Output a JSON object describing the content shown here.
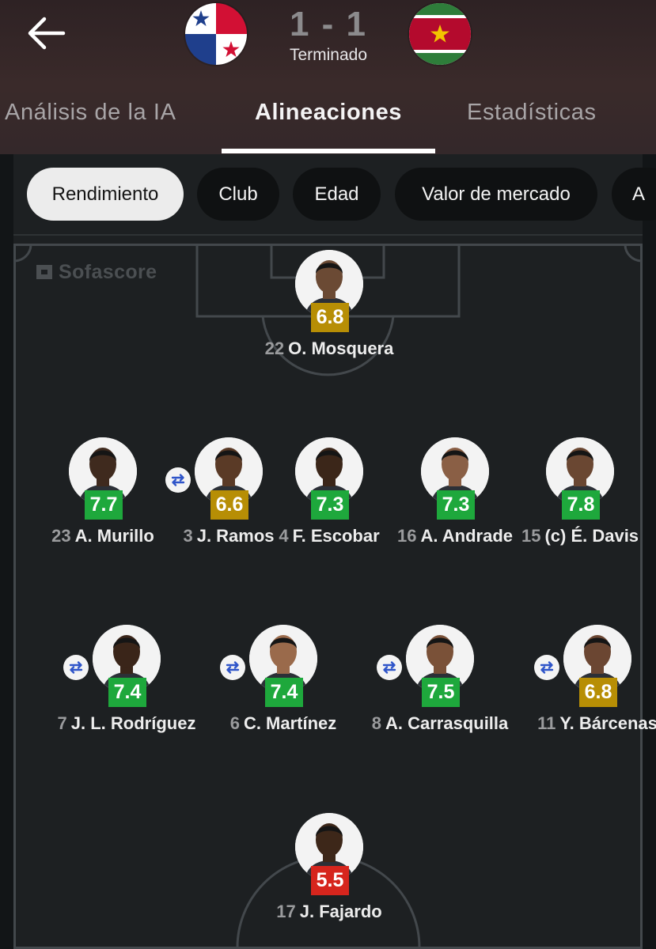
{
  "match": {
    "score": "1 - 1",
    "status": "Terminado",
    "home_team_flag": "panama-flag",
    "away_team_flag": "suriname-flag"
  },
  "tabs": [
    {
      "label": "Análisis de la IA",
      "active": false
    },
    {
      "label": "Alineaciones",
      "active": true
    },
    {
      "label": "Estadísticas",
      "active": false
    }
  ],
  "filters": [
    {
      "label": "Rendimiento",
      "active": true
    },
    {
      "label": "Club",
      "active": false
    },
    {
      "label": "Edad",
      "active": false
    },
    {
      "label": "Valor de mercado",
      "active": false
    },
    {
      "label": "A",
      "active": false
    }
  ],
  "watermark": "Sofascore",
  "players": [
    {
      "number": "22",
      "name": "O. Mosquera",
      "rating": "6.8",
      "rating_color": "gold",
      "substituted": false
    },
    {
      "number": "23",
      "name": "A. Murillo",
      "rating": "7.7",
      "rating_color": "green",
      "substituted": false
    },
    {
      "number": "3",
      "name": "J. Ramos",
      "rating": "6.6",
      "rating_color": "gold",
      "substituted": true
    },
    {
      "number": "4",
      "name": "F. Escobar",
      "rating": "7.3",
      "rating_color": "green",
      "substituted": false
    },
    {
      "number": "16",
      "name": "A. Andrade",
      "rating": "7.3",
      "rating_color": "green",
      "substituted": false
    },
    {
      "number": "15",
      "name": "(c) É. Davis",
      "rating": "7.8",
      "rating_color": "green",
      "substituted": false
    },
    {
      "number": "7",
      "name": "J. L. Rodríguez",
      "rating": "7.4",
      "rating_color": "green",
      "substituted": true
    },
    {
      "number": "6",
      "name": "C. Martínez",
      "rating": "7.4",
      "rating_color": "green",
      "substituted": true
    },
    {
      "number": "8",
      "name": "A. Carrasquilla",
      "rating": "7.5",
      "rating_color": "green",
      "substituted": true
    },
    {
      "number": "11",
      "name": "Y. Bárcenas",
      "rating": "6.8",
      "rating_color": "gold",
      "substituted": true
    },
    {
      "number": "17",
      "name": "J. Fajardo",
      "rating": "5.5",
      "rating_color": "red",
      "substituted": false
    }
  ],
  "colors": {
    "rating_green": "#1ea83c",
    "rating_gold": "#b78e05",
    "rating_red": "#d6251d",
    "pitch_line": "#43484c"
  }
}
